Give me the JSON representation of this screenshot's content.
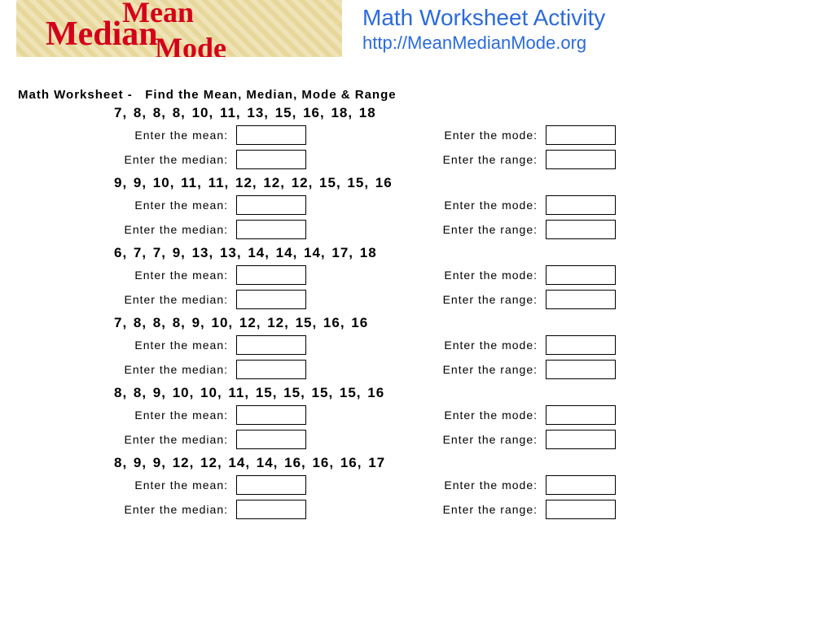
{
  "logo": {
    "w1": "Mean",
    "w2": "Median",
    "w3": "Mode"
  },
  "brand": {
    "title": "Math Worksheet Activity",
    "url": "http://MeanMedianMode.org"
  },
  "worksheet_title": "Math Worksheet -   Find the Mean, Median, Mode & Range",
  "labels": {
    "mean": "Enter the mean:",
    "median": "Enter the median:",
    "mode": "Enter the mode:",
    "range": "Enter the range:"
  },
  "problems": [
    {
      "numbers": "7, 8, 8, 8, 10, 11, 13, 15, 16, 18, 18"
    },
    {
      "numbers": "9, 9, 10, 11, 11, 12, 12, 12, 15, 15, 16"
    },
    {
      "numbers": "6, 7, 7, 9, 13, 13, 14, 14, 14, 17, 18"
    },
    {
      "numbers": "7, 8, 8, 8, 9, 10, 12, 12, 15, 16, 16"
    },
    {
      "numbers": "8, 8, 9, 10, 10, 11, 15, 15, 15, 15, 16"
    },
    {
      "numbers": "8, 9, 9, 12, 12, 14, 14, 16, 16, 16, 17"
    }
  ]
}
